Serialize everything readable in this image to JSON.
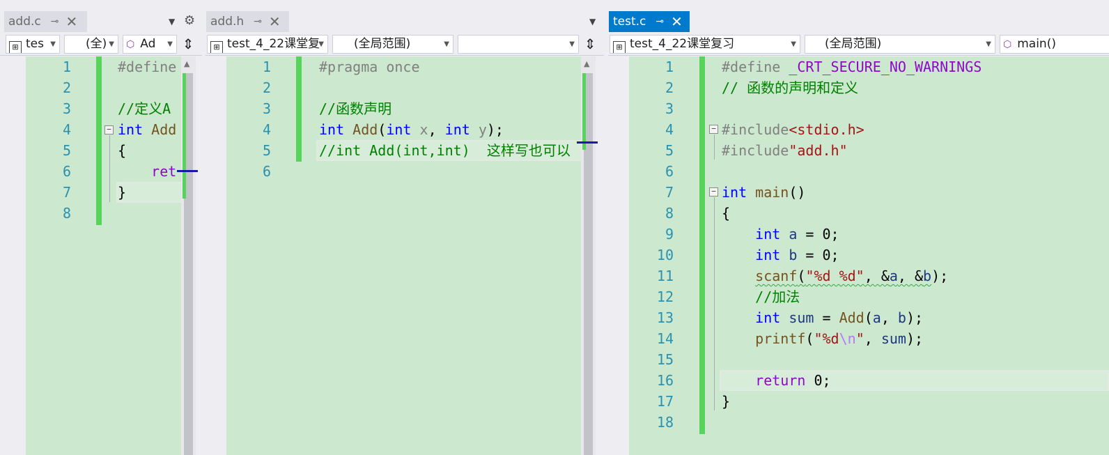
{
  "panes": [
    {
      "tab": {
        "label": "add.c",
        "active": false
      },
      "nav": {
        "project": "tes",
        "scope": "(全)",
        "member": "Ad"
      },
      "lines": [
        {
          "no": "1",
          "tokens": [
            {
              "t": "#define",
              "c": "pp"
            }
          ]
        },
        {
          "no": "2",
          "tokens": []
        },
        {
          "no": "3",
          "tokens": [
            {
              "t": "//定义A",
              "c": "cm"
            }
          ]
        },
        {
          "no": "4",
          "tokens": [
            {
              "t": "int",
              "c": "kw"
            },
            {
              "t": " ",
              "c": "txt"
            },
            {
              "t": "Add",
              "c": "fn"
            }
          ]
        },
        {
          "no": "5",
          "tokens": [
            {
              "t": "{",
              "c": "txt"
            }
          ]
        },
        {
          "no": "6",
          "tokens": [
            {
              "t": "    ",
              "c": "txt"
            },
            {
              "t": "ret",
              "c": "ctl"
            }
          ]
        },
        {
          "no": "7",
          "tokens": [
            {
              "t": "}",
              "c": "txt"
            }
          ]
        },
        {
          "no": "8",
          "tokens": []
        }
      ]
    },
    {
      "tab": {
        "label": "add.h",
        "active": false
      },
      "nav": {
        "project": "test_4_22课堂复",
        "scope": "(全局范围)",
        "member": ""
      },
      "lines": [
        {
          "no": "1",
          "tokens": [
            {
              "t": "#pragma once",
              "c": "pp"
            }
          ]
        },
        {
          "no": "2",
          "tokens": []
        },
        {
          "no": "3",
          "tokens": [
            {
              "t": "//函数声明",
              "c": "cm"
            }
          ]
        },
        {
          "no": "4",
          "tokens": [
            {
              "t": "int",
              "c": "kw"
            },
            {
              "t": " ",
              "c": "txt"
            },
            {
              "t": "Add",
              "c": "fn"
            },
            {
              "t": "(",
              "c": "txt"
            },
            {
              "t": "int",
              "c": "kw"
            },
            {
              "t": " ",
              "c": "txt"
            },
            {
              "t": "x",
              "c": "prm"
            },
            {
              "t": ", ",
              "c": "txt"
            },
            {
              "t": "int",
              "c": "kw"
            },
            {
              "t": " ",
              "c": "txt"
            },
            {
              "t": "y",
              "c": "prm"
            },
            {
              "t": ");",
              "c": "txt"
            }
          ]
        },
        {
          "no": "5",
          "tokens": [
            {
              "t": "//int Add(int,int)  这样写也可以",
              "c": "cm"
            }
          ]
        },
        {
          "no": "6",
          "tokens": []
        }
      ]
    },
    {
      "tab": {
        "label": "test.c",
        "active": true
      },
      "nav": {
        "project": "test_4_22课堂复习",
        "scope": "(全局范围)",
        "member": "main()"
      },
      "lines": [
        {
          "no": "1",
          "tokens": [
            {
              "t": "#define ",
              "c": "pp"
            },
            {
              "t": "_CRT_SECURE_NO_WARNINGS",
              "c": "mac"
            }
          ]
        },
        {
          "no": "2",
          "tokens": [
            {
              "t": "// 函数的声明和定义",
              "c": "cm"
            }
          ]
        },
        {
          "no": "3",
          "tokens": []
        },
        {
          "no": "4",
          "tokens": [
            {
              "t": "#include",
              "c": "pp"
            },
            {
              "t": "<stdio.h>",
              "c": "str"
            }
          ]
        },
        {
          "no": "5",
          "tokens": [
            {
              "t": "#include",
              "c": "pp"
            },
            {
              "t": "\"add.h\"",
              "c": "str"
            }
          ]
        },
        {
          "no": "6",
          "tokens": []
        },
        {
          "no": "7",
          "tokens": [
            {
              "t": "int",
              "c": "kw"
            },
            {
              "t": " ",
              "c": "txt"
            },
            {
              "t": "main",
              "c": "fn"
            },
            {
              "t": "()",
              "c": "txt"
            }
          ]
        },
        {
          "no": "8",
          "tokens": [
            {
              "t": "{",
              "c": "txt"
            }
          ]
        },
        {
          "no": "9",
          "tokens": [
            {
              "t": "    ",
              "c": "txt"
            },
            {
              "t": "int",
              "c": "kw"
            },
            {
              "t": " ",
              "c": "txt"
            },
            {
              "t": "a",
              "c": "var"
            },
            {
              "t": " = 0;",
              "c": "txt"
            }
          ]
        },
        {
          "no": "10",
          "tokens": [
            {
              "t": "    ",
              "c": "txt"
            },
            {
              "t": "int",
              "c": "kw"
            },
            {
              "t": " ",
              "c": "txt"
            },
            {
              "t": "b",
              "c": "var"
            },
            {
              "t": " = 0;",
              "c": "txt"
            }
          ]
        },
        {
          "no": "11",
          "tokens": [
            {
              "t": "    ",
              "c": "txt"
            },
            {
              "t": "scanf",
              "c": "fn",
              "sq": true
            },
            {
              "t": "(",
              "c": "txt",
              "sq": true
            },
            {
              "t": "\"%d %d\"",
              "c": "str",
              "sq": true
            },
            {
              "t": ", &",
              "c": "txt",
              "sq": true
            },
            {
              "t": "a",
              "c": "var",
              "sq": true
            },
            {
              "t": ", &",
              "c": "txt",
              "sq": true
            },
            {
              "t": "b",
              "c": "var",
              "sq": true
            },
            {
              "t": ");",
              "c": "txt"
            }
          ]
        },
        {
          "no": "12",
          "tokens": [
            {
              "t": "    ",
              "c": "txt"
            },
            {
              "t": "//加法",
              "c": "cm"
            }
          ]
        },
        {
          "no": "13",
          "tokens": [
            {
              "t": "    ",
              "c": "txt"
            },
            {
              "t": "int",
              "c": "kw"
            },
            {
              "t": " ",
              "c": "txt"
            },
            {
              "t": "sum",
              "c": "var"
            },
            {
              "t": " = ",
              "c": "txt"
            },
            {
              "t": "Add",
              "c": "fn"
            },
            {
              "t": "(",
              "c": "txt"
            },
            {
              "t": "a",
              "c": "var"
            },
            {
              "t": ", ",
              "c": "txt"
            },
            {
              "t": "b",
              "c": "var"
            },
            {
              "t": ");",
              "c": "txt"
            }
          ]
        },
        {
          "no": "14",
          "tokens": [
            {
              "t": "    ",
              "c": "txt"
            },
            {
              "t": "printf",
              "c": "fn"
            },
            {
              "t": "(",
              "c": "txt"
            },
            {
              "t": "\"%d",
              "c": "str"
            },
            {
              "t": "\\n",
              "c": "esc"
            },
            {
              "t": "\"",
              "c": "str"
            },
            {
              "t": ", ",
              "c": "txt"
            },
            {
              "t": "sum",
              "c": "var"
            },
            {
              "t": ");",
              "c": "txt"
            }
          ]
        },
        {
          "no": "15",
          "tokens": []
        },
        {
          "no": "16",
          "tokens": [
            {
              "t": "    ",
              "c": "txt"
            },
            {
              "t": "return",
              "c": "ctl"
            },
            {
              "t": " 0;",
              "c": "txt"
            }
          ]
        },
        {
          "no": "17",
          "tokens": [
            {
              "t": "}",
              "c": "txt"
            }
          ]
        },
        {
          "no": "18",
          "tokens": []
        }
      ]
    }
  ],
  "icons": {
    "pin": "pin-icon",
    "close": "close-icon",
    "gear": "gear-icon",
    "split": "split-icon"
  }
}
